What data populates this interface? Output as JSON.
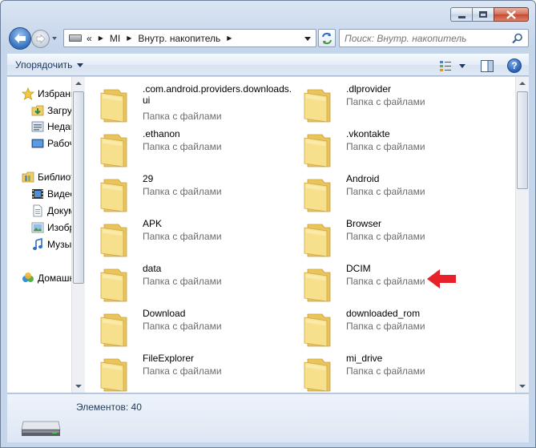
{
  "address": {
    "overflow": "«",
    "crumbs": [
      "MI",
      "Внутр. накопитель"
    ]
  },
  "search": {
    "placeholder": "Поиск: Внутр. накопитель"
  },
  "toolbar": {
    "organize_label": "Упорядочить"
  },
  "navpane": {
    "items": [
      {
        "label": "Избранное",
        "icon": "star-icon"
      },
      {
        "label": "Загрузки",
        "icon": "downloads-icon"
      },
      {
        "label": "Недавние места",
        "icon": "recent-places-icon"
      },
      {
        "label": "Рабочий стол",
        "icon": "desktop-icon"
      },
      {
        "label": "Библиотеки",
        "icon": "libraries-icon"
      },
      {
        "label": "Видео",
        "icon": "video-icon"
      },
      {
        "label": "Документы",
        "icon": "documents-icon"
      },
      {
        "label": "Изображения",
        "icon": "images-icon"
      },
      {
        "label": "Музыка",
        "icon": "music-icon"
      },
      {
        "label": "Домашняя группа",
        "icon": "homegroup-icon"
      }
    ]
  },
  "files": {
    "items": [
      {
        "name": ".com.android.providers.downloads.ui",
        "type": "Папка с файлами"
      },
      {
        "name": ".dlprovider",
        "type": "Папка с файлами"
      },
      {
        "name": ".ethanon",
        "type": "Папка с файлами"
      },
      {
        "name": ".vkontakte",
        "type": "Папка с файлами"
      },
      {
        "name": "29",
        "type": "Папка с файлами"
      },
      {
        "name": "Android",
        "type": "Папка с файлами"
      },
      {
        "name": "APK",
        "type": "Папка с файлами"
      },
      {
        "name": "Browser",
        "type": "Папка с файлами"
      },
      {
        "name": "data",
        "type": "Папка с файлами"
      },
      {
        "name": "DCIM",
        "type": "Папка с файлами"
      },
      {
        "name": "Download",
        "type": "Папка с файлами"
      },
      {
        "name": "downloaded_rom",
        "type": "Папка с файлами"
      },
      {
        "name": "FileExplorer",
        "type": "Папка с файлами"
      },
      {
        "name": "mi_drive",
        "type": "Папка с файлами"
      }
    ]
  },
  "details": {
    "count": "Элементов: 40"
  },
  "colors": {
    "highlight_arrow": "#e8202a",
    "folder": "#f2d878"
  }
}
